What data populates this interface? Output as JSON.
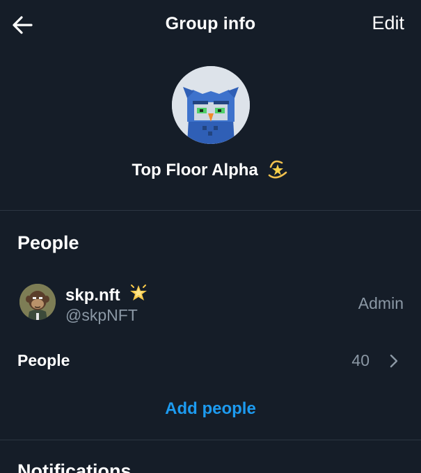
{
  "header": {
    "title": "Group info",
    "edit_label": "Edit",
    "back_icon": "arrow-left-icon"
  },
  "group": {
    "name": "Top Floor Alpha",
    "name_emoji": "dizzy-star-icon",
    "avatar": "blue-owl-avatar"
  },
  "people_section": {
    "heading": "People",
    "members": [
      {
        "name": "skp.nft",
        "name_emoji": "glowing-star-icon",
        "handle": "@skpNFT",
        "role": "Admin",
        "avatar": "ape-avatar"
      }
    ],
    "people_row": {
      "label": "People",
      "count": "40",
      "chevron_icon": "chevron-right-icon"
    },
    "add_people_label": "Add people"
  },
  "notifications_section": {
    "heading": "Notifications"
  },
  "colors": {
    "background": "#151d28",
    "divider": "#2c3642",
    "secondary_text": "#8b98a5",
    "accent": "#1d9bf0"
  }
}
